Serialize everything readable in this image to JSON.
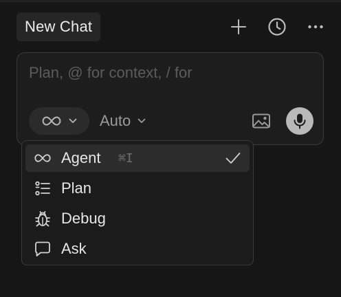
{
  "header": {
    "tab_title": "New Chat",
    "icons": [
      "plus-icon",
      "history-icon",
      "more-icon"
    ]
  },
  "composer": {
    "placeholder": "Plan, @ for context, / for",
    "mode_icon": "infinity-icon",
    "model_label": "Auto",
    "image_icon": "image-icon",
    "mic_icon": "microphone-icon"
  },
  "mode_menu": {
    "items": [
      {
        "label": "Agent",
        "shortcut": "⌘I",
        "icon": "infinity-icon",
        "selected": true
      },
      {
        "label": "Plan",
        "shortcut": "",
        "icon": "checklist-icon",
        "selected": false
      },
      {
        "label": "Debug",
        "shortcut": "",
        "icon": "bug-icon",
        "selected": false
      },
      {
        "label": "Ask",
        "shortcut": "",
        "icon": "chat-bubble-icon",
        "selected": false
      }
    ]
  },
  "colors": {
    "background": "#161616",
    "surface": "#1d1d1d",
    "border": "#3a3a3a",
    "selected": "#2c2c2c",
    "mic": "#b9b9b9"
  }
}
